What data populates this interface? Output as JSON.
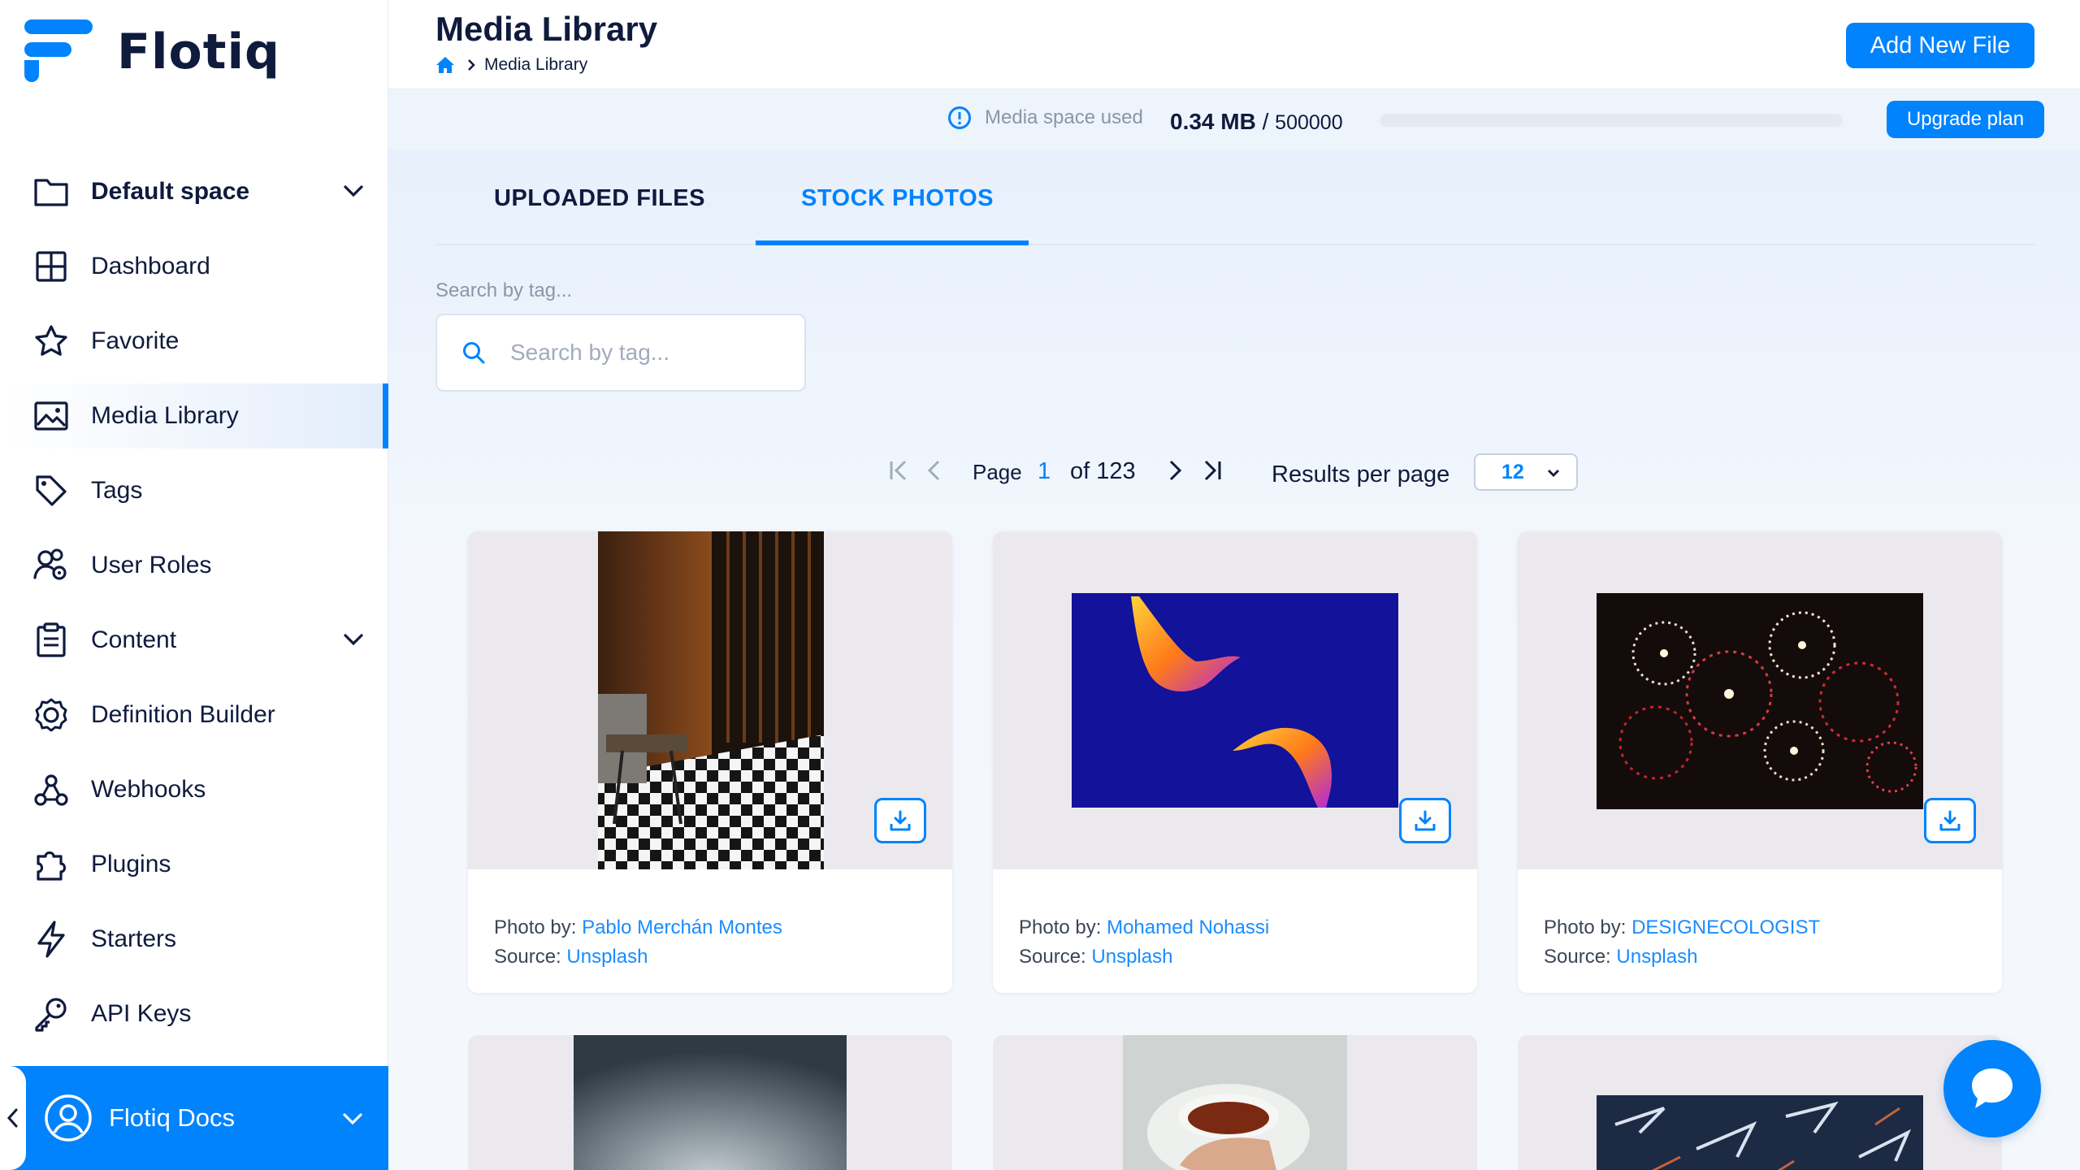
{
  "app": {
    "name": "Flotiq"
  },
  "sidebar": {
    "items": [
      {
        "label": "Default space",
        "icon": "folder-icon"
      },
      {
        "label": "Dashboard",
        "icon": "dashboard-grid-icon"
      },
      {
        "label": "Favorite",
        "icon": "star-icon"
      },
      {
        "label": "Media Library",
        "icon": "image-icon"
      },
      {
        "label": "Tags",
        "icon": "tag-icon"
      },
      {
        "label": "User Roles",
        "icon": "user-roles-icon"
      },
      {
        "label": "Content",
        "icon": "clipboard-icon"
      },
      {
        "label": "Definition Builder",
        "icon": "gear-icon"
      },
      {
        "label": "Webhooks",
        "icon": "webhook-icon"
      },
      {
        "label": "Plugins",
        "icon": "puzzle-icon"
      },
      {
        "label": "Starters",
        "icon": "lightning-icon"
      },
      {
        "label": "API Keys",
        "icon": "key-icon"
      }
    ],
    "account_label": "Flotiq Docs"
  },
  "header": {
    "title": "Media Library",
    "breadcrumb_current": "Media Library",
    "add_button": "Add New File"
  },
  "usage": {
    "label": "Media space used",
    "used": "0.34 MB",
    "separator": "/",
    "total": "500000",
    "fraction_used": 0.0,
    "upgrade_button": "Upgrade plan"
  },
  "tabs": [
    {
      "label": "UPLOADED FILES",
      "active": false
    },
    {
      "label": "STOCK PHOTOS",
      "active": true
    }
  ],
  "search": {
    "label": "Search by tag...",
    "placeholder": "Search by tag..."
  },
  "pagination": {
    "page_label": "Page",
    "current_page": "1",
    "of_label": "of 123",
    "results_label": "Results per page",
    "per_page": "12"
  },
  "photos": [
    {
      "photo_by_label": "Photo by:",
      "author": "Pablo Merchán Montes",
      "source_label": "Source:",
      "source": "Unsplash"
    },
    {
      "photo_by_label": "Photo by:",
      "author": "Mohamed Nohassi",
      "source_label": "Source:",
      "source": "Unsplash"
    },
    {
      "photo_by_label": "Photo by:",
      "author": "DESIGNECOLOGIST",
      "source_label": "Source:",
      "source": "Unsplash"
    }
  ],
  "colors": {
    "accent": "#0083fc",
    "text_dark": "#0f1b3d",
    "muted": "#8a96a8"
  }
}
